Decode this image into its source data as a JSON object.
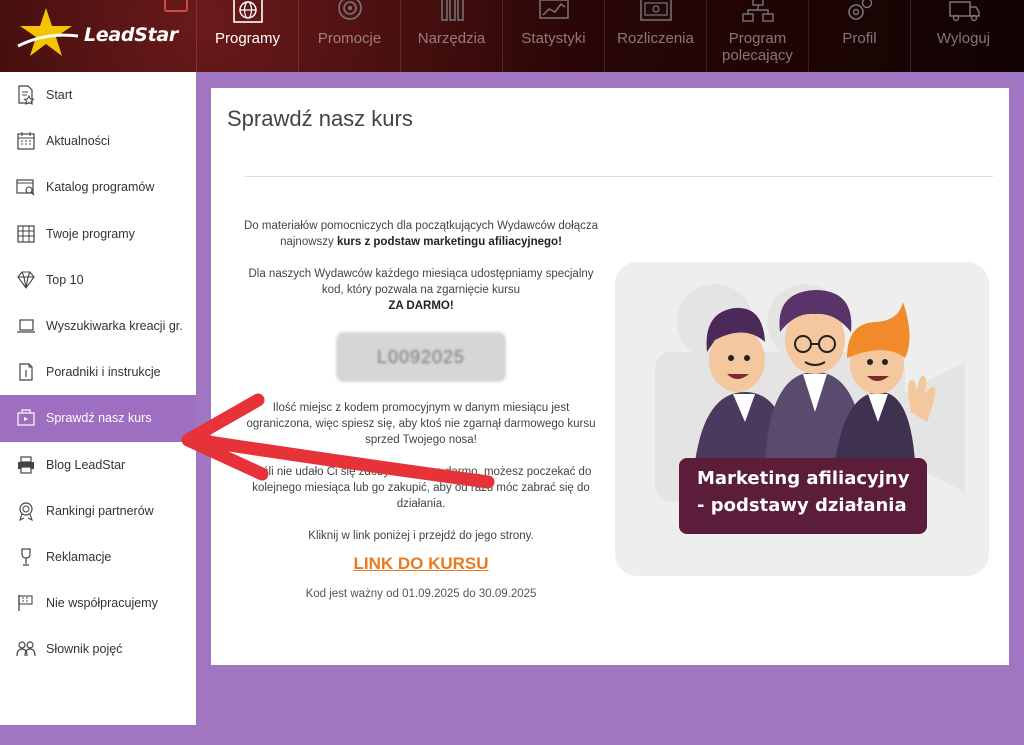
{
  "header": {
    "logo_text": "LeadStar",
    "nav": [
      {
        "label": "Programy",
        "icon": "globe-icon",
        "active": true
      },
      {
        "label": "Promocje",
        "icon": "target-icon",
        "active": false
      },
      {
        "label": "Narzędzia",
        "icon": "tools-icon",
        "active": false
      },
      {
        "label": "Statystyki",
        "icon": "stats-icon",
        "active": false
      },
      {
        "label": "Rozliczenia",
        "icon": "money-icon",
        "active": false
      },
      {
        "label": "Program polecający",
        "icon": "network-icon",
        "active": false
      },
      {
        "label": "Profil",
        "icon": "gears-icon",
        "active": false
      },
      {
        "label": "Wyloguj",
        "icon": "truck-icon",
        "active": false
      }
    ]
  },
  "sidebar": {
    "items": [
      {
        "label": "Start",
        "icon": "document-star-icon"
      },
      {
        "label": "Aktualności",
        "icon": "calendar-icon"
      },
      {
        "label": "Katalog programów",
        "icon": "catalog-search-icon"
      },
      {
        "label": "Twoje programy",
        "icon": "grid-list-icon"
      },
      {
        "label": "Top 10",
        "icon": "diamond-icon"
      },
      {
        "label": "Wyszukiwarka kreacji gr.",
        "icon": "laptop-icon"
      },
      {
        "label": "Poradniki i instrukcje",
        "icon": "guide-icon"
      },
      {
        "label": "Sprawdź nasz kurs",
        "icon": "course-icon",
        "active": true
      },
      {
        "label": "Blog LeadStar",
        "icon": "printer-icon"
      },
      {
        "label": "Rankingi partnerów",
        "icon": "medal-icon"
      },
      {
        "label": "Reklamacje",
        "icon": "complaint-icon"
      },
      {
        "label": "Nie współpracujemy",
        "icon": "flag-icon"
      },
      {
        "label": "Słownik pojęć",
        "icon": "people-icon"
      }
    ]
  },
  "main": {
    "title": "Sprawdź nasz kurs",
    "para1_a": "Do materiałów pomocniczych dla początkujących Wydawców dołącza najnowszy ",
    "para1_b": "kurs z podstaw marketingu afiliacyjnego!",
    "para2": "Dla naszych Wydawców każdego miesiąca udostępniamy specjalny kod, który pozwala na zgarnięcie kursu",
    "para2_bold": "ZA DARMO!",
    "code": "L0092025",
    "para3": "Ilość miejsc z kodem promocyjnym w danym miesiącu jest ograniczona, więc spiesz się, aby ktoś nie zgarnął darmowego kursu sprzed Twojego nosa!",
    "para4": "Jeśli nie udało Ci się zdobyć kursu za darmo, możesz poczekać do kolejnego miesiąca lub go zakupić, aby od razu móc zabrać się do działania.",
    "para5": "Kliknij w link poniżej i przejdź do jego strony.",
    "link_label": "LINK DO KURSU",
    "validity": "Kod jest ważny od 01.09.2025 do 30.09.2025",
    "banner_line1": "Marketing afiliacyjny",
    "banner_line2": "- podstawy działania"
  }
}
